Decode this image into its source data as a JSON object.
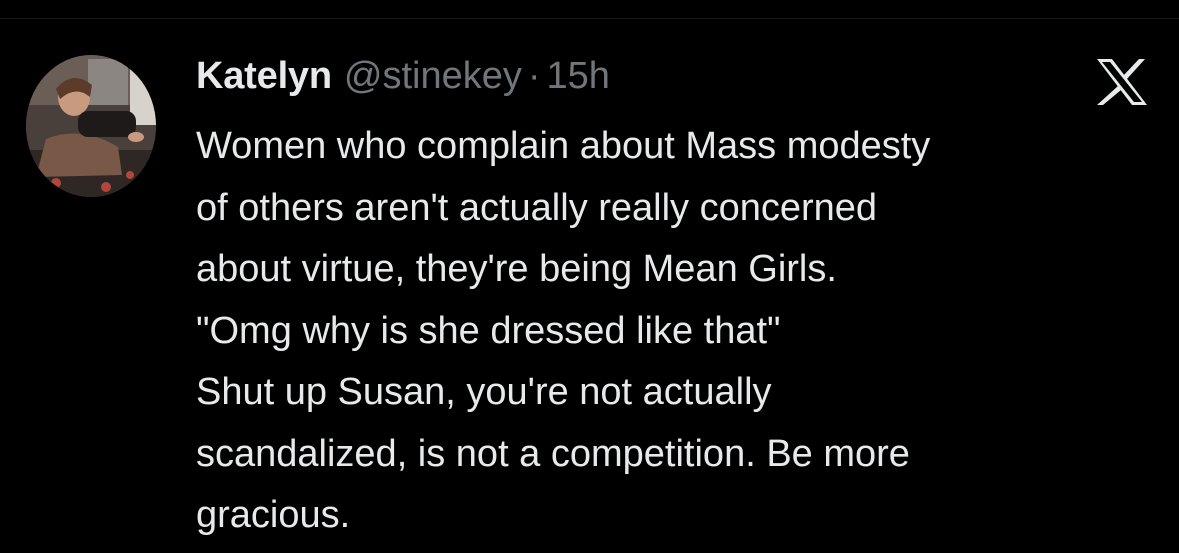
{
  "author": {
    "display_name": "Katelyn",
    "handle": "@stinekey",
    "separator": "·",
    "time": "15h"
  },
  "icons": {
    "avatar": "profile-photo",
    "brand": "x-logo-icon"
  },
  "colors": {
    "background": "#000000",
    "text_primary": "#e7e9ea",
    "text_secondary": "#71767b"
  },
  "tweet": {
    "lines": [
      "Women who complain about Mass modesty",
      "of others aren't actually really concerned",
      "about virtue, they're being Mean Girls.",
      "\"Omg why is she dressed like that\"",
      "Shut up Susan, you're not actually",
      "scandalized, is not a competition. Be more",
      "gracious."
    ]
  }
}
